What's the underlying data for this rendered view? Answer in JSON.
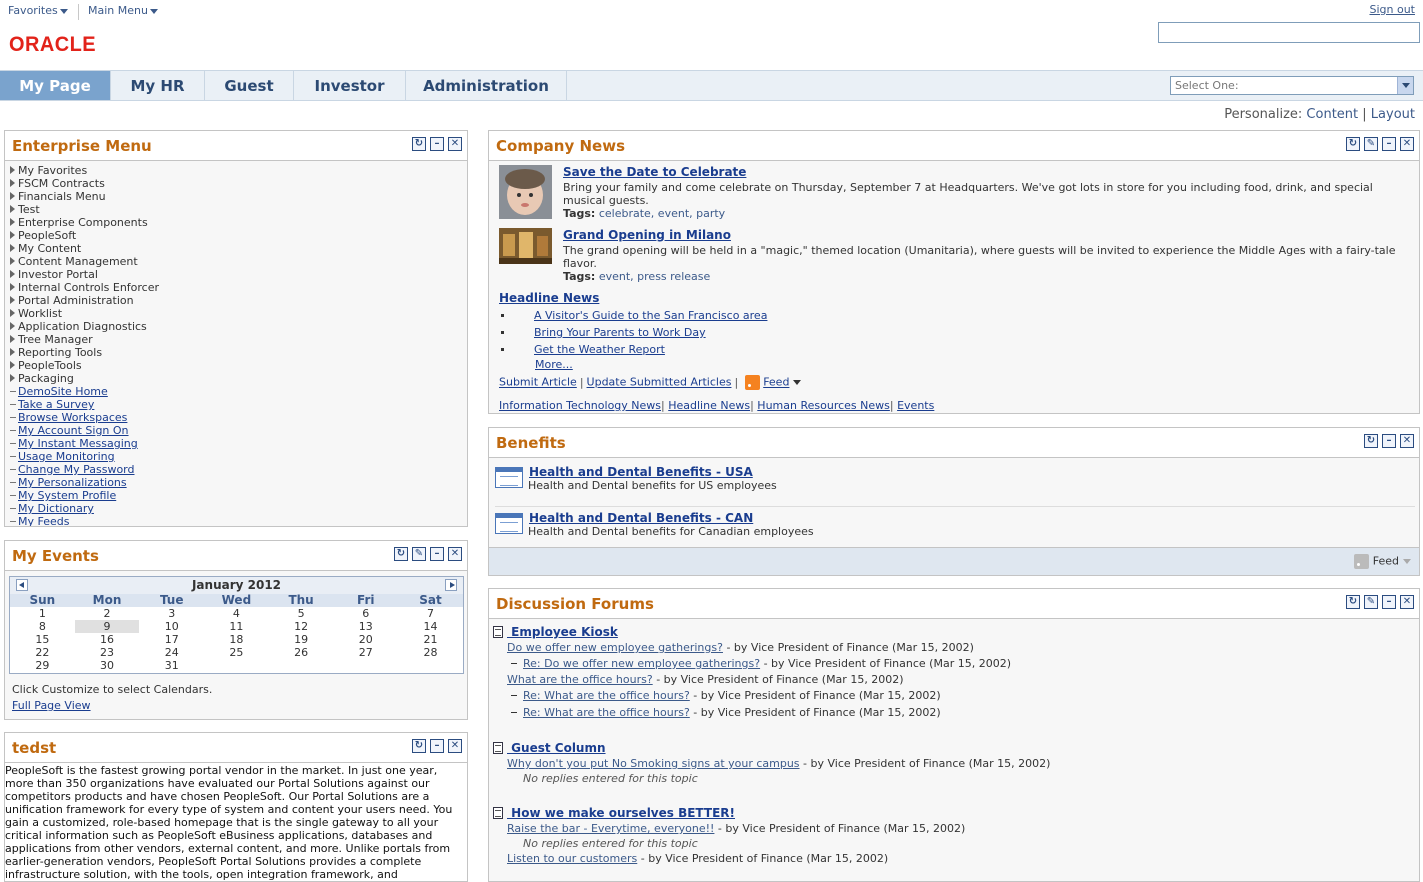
{
  "topnav": {
    "favorites": "Favorites",
    "main_menu": "Main Menu",
    "sign_out": "Sign out",
    "logo_text": "ORACLE"
  },
  "tabs": [
    {
      "label": "My Page",
      "active": true
    },
    {
      "label": "My HR"
    },
    {
      "label": "Guest"
    },
    {
      "label": "Investor"
    },
    {
      "label": "Administration"
    }
  ],
  "select_one": "Select One:",
  "personalize": {
    "label": "Personalize:",
    "content": "Content",
    "sep": "|",
    "layout": "Layout"
  },
  "enterprise_menu": {
    "title": "Enterprise Menu",
    "folders": [
      "My Favorites",
      "FSCM Contracts",
      "Financials Menu",
      "Test",
      "Enterprise Components",
      "PeopleSoft",
      "My Content",
      "Content Management",
      "Investor Portal",
      "Internal Controls Enforcer",
      "Portal Administration",
      "Worklist",
      "Application Diagnostics",
      "Tree Manager",
      "Reporting Tools",
      "PeopleTools",
      "Packaging"
    ],
    "links": [
      "DemoSite Home",
      "Take a Survey",
      "Browse Workspaces",
      "My Account Sign On",
      "My Instant Messaging",
      "Usage Monitoring",
      "Change My Password",
      "My Personalizations",
      "My System Profile",
      "My Dictionary",
      "My Feeds"
    ]
  },
  "my_events": {
    "title": "My Events",
    "month": "January 2012",
    "days": [
      "Sun",
      "Mon",
      "Tue",
      "Wed",
      "Thu",
      "Fri",
      "Sat"
    ],
    "weeks": [
      [
        "1",
        "2",
        "3",
        "4",
        "5",
        "6",
        "7"
      ],
      [
        "8",
        "9",
        "10",
        "11",
        "12",
        "13",
        "14"
      ],
      [
        "15",
        "16",
        "17",
        "18",
        "19",
        "20",
        "21"
      ],
      [
        "22",
        "23",
        "24",
        "25",
        "26",
        "27",
        "28"
      ],
      [
        "29",
        "30",
        "31",
        "",
        "",
        "",
        ""
      ]
    ],
    "note": "Click Customize to select Calendars.",
    "full_page": "Full Page View"
  },
  "tedst": {
    "title": "tedst",
    "body": "PeopleSoft is the fastest growing portal vendor in the market. In just one year, more than 350 organizations have evaluated our Portal Solutions against our competitors products and have chosen PeopleSoft. Our Portal Solutions are a unification framework for every type of system and content your users need. You gain a customized, role-based homepage that is the single gateway to all your critical information such as PeopleSoft eBusiness applications, databases and applications from other vendors, external content, and more. Unlike portals from earlier-generation vendors, PeopleSoft Portal Solutions provides a complete infrastructure solution, with the tools, open integration framework, and"
  },
  "company_news": {
    "title": "Company News",
    "items": [
      {
        "title": "Save the Date to Celebrate",
        "desc": "Bring your family and come celebrate on Thursday, September 7 at Headquarters. We've got lots in store for you including food, drink, and special musical guests.",
        "tags_label": "Tags:",
        "tags": "celebrate, event, party"
      },
      {
        "title": "Grand Opening in Milano",
        "desc": "The grand opening will be held in a \"magic,\" themed location (Umanitaria), where guests will be invited to experience the Middle Ages with a fairy-tale flavor.",
        "tags_label": "Tags:",
        "tags": "event, press release"
      }
    ],
    "headline_title": "Headline News",
    "headlines": [
      "A Visitor's Guide to the San Francisco area",
      "Bring Your Parents to Work Day",
      "Get the Weather Report"
    ],
    "more": "More...",
    "submit": "Submit Article",
    "update": "Update Submitted Articles",
    "feed": "Feed",
    "categories": [
      "Information Technology News",
      "Headline News",
      "Human Resources News",
      "Events"
    ],
    "sep": "|"
  },
  "benefits": {
    "title": "Benefits",
    "items": [
      {
        "title": "Health and Dental Benefits - USA",
        "desc": "Health and Dental benefits for US employees"
      },
      {
        "title": "Health and Dental Benefits - CAN",
        "desc": "Health and Dental benefits for Canadian employees"
      }
    ],
    "feed": "Feed"
  },
  "forums": {
    "title": "Discussion Forums",
    "by": "- by Vice President of Finance (Mar 15, 2002)",
    "no_replies": "No replies entered for this topic",
    "f1": {
      "name": " Employee Kiosk",
      "t1": "Do we offer new employee gatherings?",
      "r1": "Re: Do we offer new employee gatherings?",
      "t2": "What are the office hours?",
      "r2": "Re: What are the office hours?",
      "r3": "Re: What are the office hours?"
    },
    "f2": {
      "name": " Guest Column",
      "t1": "Why don't you put No Smoking signs at your campus"
    },
    "f3": {
      "name": " How we make ourselves BETTER!",
      "t1": "Raise the bar - Everytime, everyone!!",
      "t2": "Listen to our customers"
    }
  },
  "colors": {
    "accent": "#c06a10",
    "tab_active": "#7aa3cd",
    "link": "#1a3d8f",
    "logo": "#e2231a"
  }
}
